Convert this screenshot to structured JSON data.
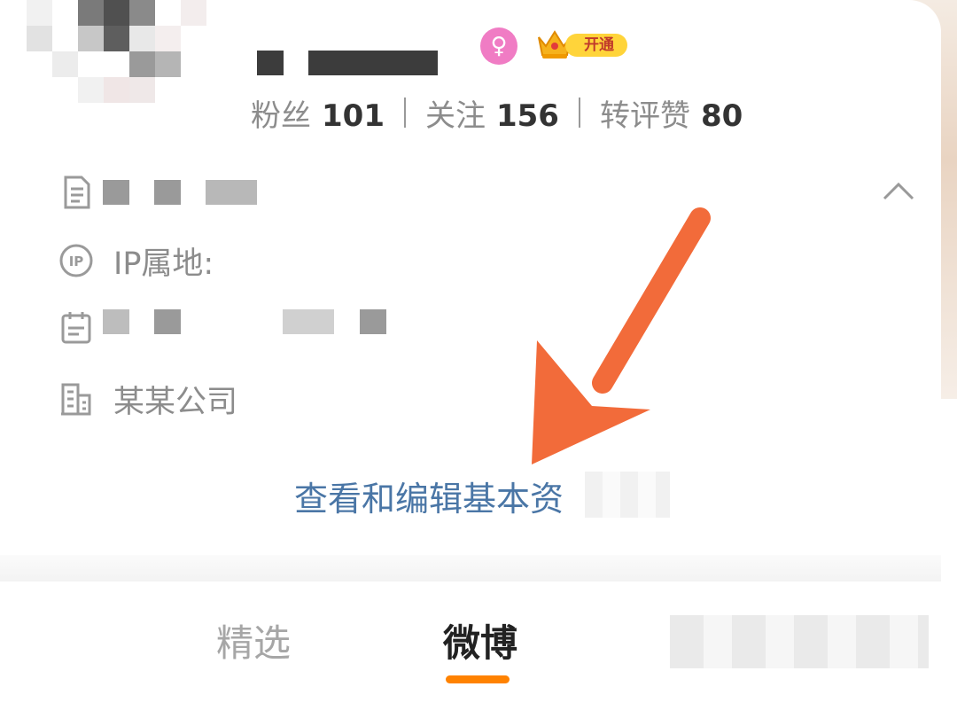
{
  "profile": {
    "vip_label": "开通",
    "gender_icon": "female-icon"
  },
  "stats": {
    "followers_label": "粉丝",
    "followers_value": "101",
    "following_label": "关注",
    "following_value": "156",
    "interactions_label": "转评赞",
    "interactions_value": "80"
  },
  "info": {
    "ip_label": "IP属地:",
    "company": "某某公司"
  },
  "actions": {
    "view_edit": "查看和编辑基本资"
  },
  "tabs": [
    {
      "label": "精选",
      "active": false
    },
    {
      "label": "微博",
      "active": true
    }
  ],
  "colors": {
    "accent": "#ff8200",
    "link": "#4a76a6",
    "annotation_arrow": "#f26b3a"
  }
}
